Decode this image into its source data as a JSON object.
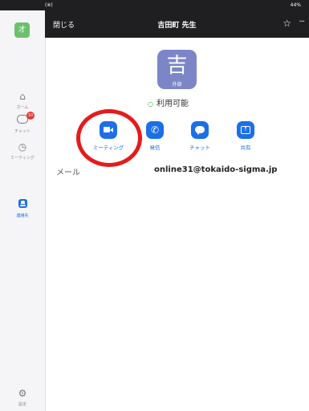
{
  "status_bar": {
    "left": "(※)",
    "right": "44%"
  },
  "header": {
    "close_label": "閉じる",
    "title": "吉田町 先生",
    "star_icon": "☆",
    "more_icon": "···"
  },
  "sidebar": {
    "avatar_letter": "オ",
    "items": [
      {
        "label": "ホーム",
        "icon": "home-icon"
      },
      {
        "label": "チャット",
        "icon": "chat-icon",
        "badge": "10"
      },
      {
        "label": "ミーティング",
        "icon": "clock-icon"
      },
      {
        "label": "連絡先",
        "icon": "contacts-icon",
        "active": true
      }
    ],
    "settings_label": "設定"
  },
  "profile": {
    "avatar_char": "吉",
    "tag": "外部",
    "status": "利用可能",
    "status_color": "#2fb34a"
  },
  "actions": [
    {
      "label": "ミーティング",
      "icon": "video-camera-icon"
    },
    {
      "label": "発信",
      "icon": "phone-icon"
    },
    {
      "label": "チャット",
      "icon": "chat-bubble-icon"
    },
    {
      "label": "共有",
      "icon": "share-screen-icon"
    }
  ],
  "contact": {
    "mail_label": "メール",
    "mail_value": "online31@tokaido-sigma.jp"
  },
  "colors": {
    "accent": "#1c6fe6",
    "header_bg": "#1f1f22",
    "annotation": "#e51b1b"
  }
}
